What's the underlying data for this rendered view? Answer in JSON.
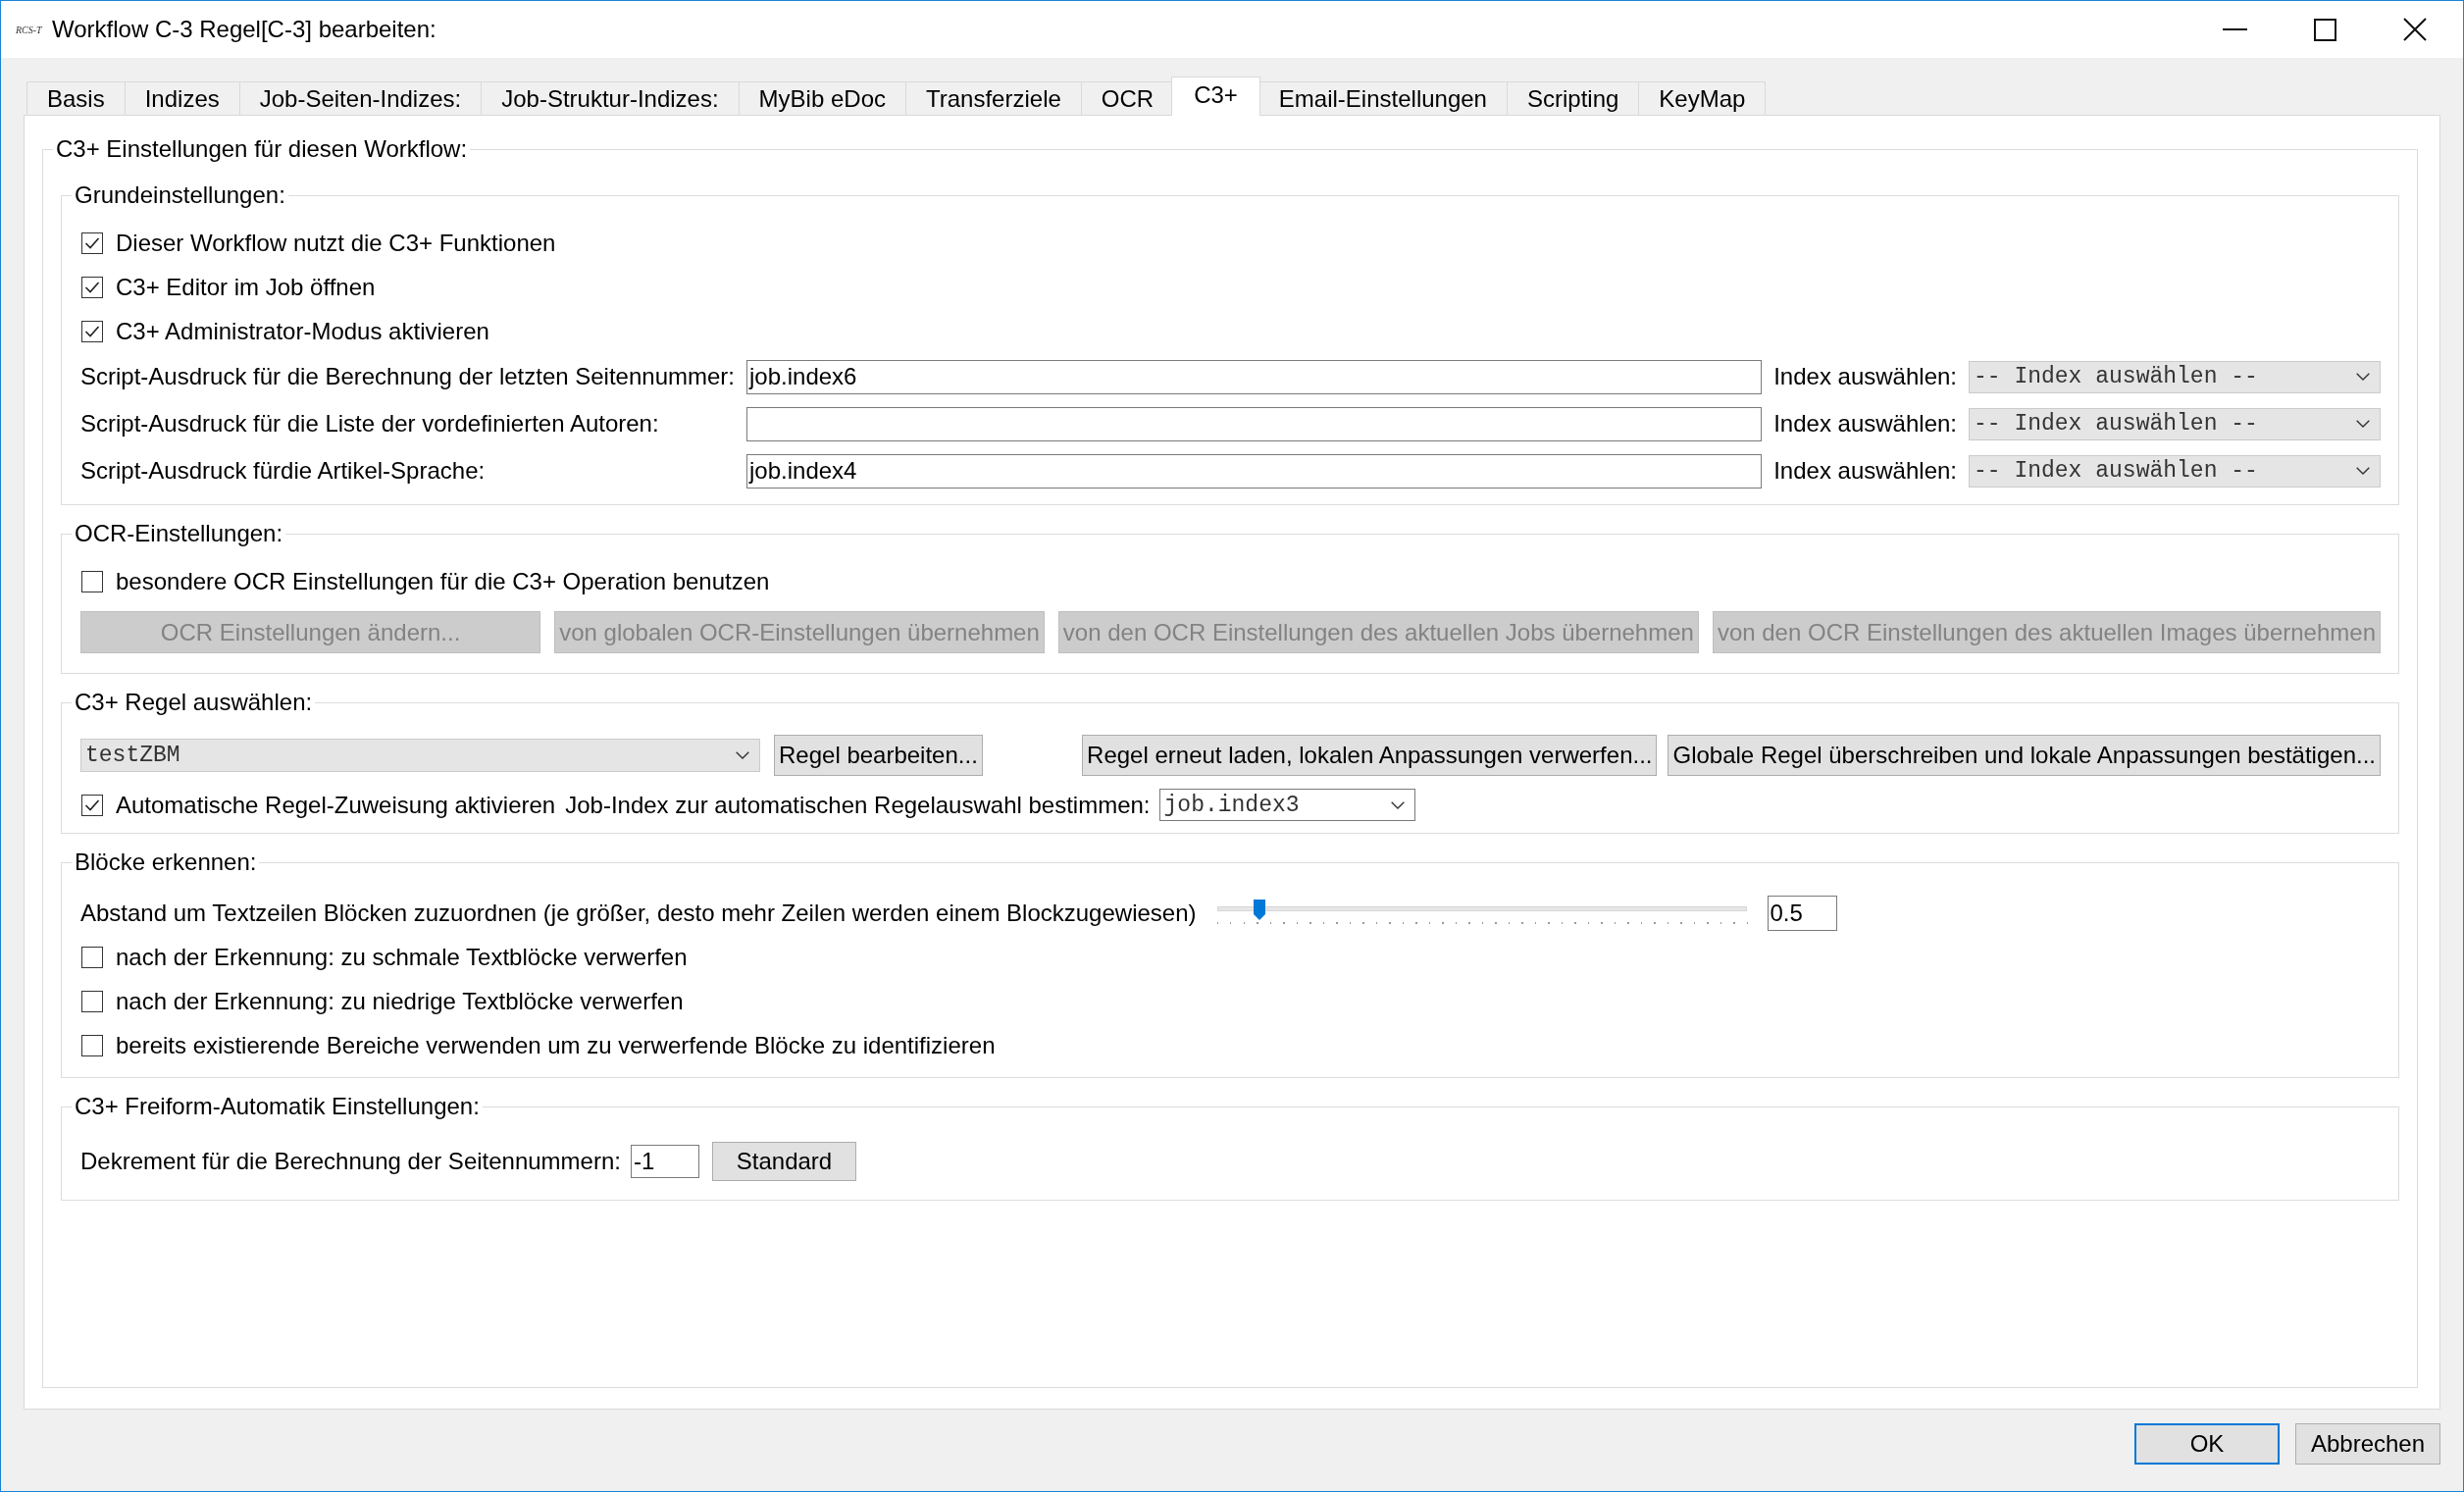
{
  "window": {
    "logo": "RCS-T",
    "title": "Workflow C-3 Regel[C-3] bearbeiten:"
  },
  "tabs": [
    {
      "label": "Basis",
      "selected": false
    },
    {
      "label": "Indizes",
      "selected": false
    },
    {
      "label": "Job-Seiten-Indizes:",
      "selected": false
    },
    {
      "label": "Job-Struktur-Indizes:",
      "selected": false
    },
    {
      "label": "MyBib eDoc",
      "selected": false
    },
    {
      "label": "Transferziele",
      "selected": false
    },
    {
      "label": "OCR",
      "selected": false
    },
    {
      "label": "C3+",
      "selected": true
    },
    {
      "label": "Email-Einstellungen",
      "selected": false
    },
    {
      "label": "Scripting",
      "selected": false
    },
    {
      "label": "KeyMap",
      "selected": false
    }
  ],
  "panel": {
    "title": "C3+ Einstellungen für diesen Workflow:"
  },
  "basic_settings": {
    "title": "Grundeinstellungen:",
    "options": [
      {
        "label": "Dieser Workflow nutzt die C3+ Funktionen",
        "checked": true
      },
      {
        "label": "C3+ Editor im Job öffnen",
        "checked": true
      },
      {
        "label": "C3+ Administrator-Modus aktivieren",
        "checked": true
      }
    ],
    "script_rows": [
      {
        "label": "Script-Ausdruck für die Berechnung der letzten Seitennummer:",
        "value": "job.index6",
        "index_label": "Index auswählen:",
        "index_choice": "-- Index auswählen --"
      },
      {
        "label": "Script-Ausdruck für die Liste der vordefinierten Autoren:",
        "index_label": "Index auswählen:",
        "index_choice": "-- Index auswählen --"
      },
      {
        "label": "Script-Ausdruck fürdie Artikel-Sprache:",
        "value": "job.index4",
        "index_label": "Index auswählen:",
        "index_choice": "-- Index auswählen --"
      }
    ]
  },
  "ocr_settings": {
    "title": "OCR-Einstellungen:",
    "option": {
      "label": "besondere OCR Einstellungen für die C3+ Operation benutzen",
      "checked": false
    },
    "buttons": [
      {
        "label": "OCR Einstellungen ändern...",
        "disabled": true
      },
      {
        "label": "von globalen OCR-Einstellungen übernehmen",
        "disabled": true
      },
      {
        "label": "von den OCR Einstellungen des aktuellen Jobs übernehmen",
        "disabled": true
      },
      {
        "label": "von den OCR Einstellungen des aktuellen Images übernehmen",
        "disabled": true
      }
    ]
  },
  "rule_selection": {
    "title": "C3+ Regel auswählen:",
    "rule": "testZBM",
    "buttons": [
      {
        "label": "Regel bearbeiten...",
        "disabled": false
      },
      {
        "label": "Regel erneut laden, lokalen Anpassungen verwerfen...",
        "disabled": false
      },
      {
        "label": "Globale Regel überschreiben und lokale Anpassungen bestätigen...",
        "disabled": false
      }
    ],
    "auto_assign": {
      "label": "Automatische Regel-Zuweisung aktivieren",
      "checked": true
    },
    "job_index_label": "Job-Index zur automatischen Regelauswahl bestimmen:",
    "job_index": "job.index3"
  },
  "block_detection": {
    "title": "Blöcke erkennen:",
    "distance": {
      "label": "Abstand um Textzeilen Blöcken zuzuordnen (je größer, desto mehr Zeilen werden einem Blockzugewiesen)",
      "level": 0.08,
      "value": "0.5"
    },
    "options": [
      {
        "label": "nach der Erkennung: zu schmale Textblöcke verwerfen",
        "checked": false
      },
      {
        "label": "nach der Erkennung: zu niedrige Textblöcke verwerfen",
        "checked": false
      },
      {
        "label": "bereits existierende Bereiche verwenden um zu verwerfende Blöcke zu identifizieren",
        "checked": false
      }
    ]
  },
  "freeform_settings": {
    "title": "C3+ Freiform-Automatik Einstellungen:",
    "decrement": {
      "label": "Dekrement für die Berechnung der Seitennummern:",
      "value": "-1"
    },
    "button": "Standard"
  },
  "footer": {
    "buttons": [
      {
        "label": "OK",
        "default": true
      },
      {
        "label": "Abbrechen",
        "default": false
      }
    ]
  }
}
